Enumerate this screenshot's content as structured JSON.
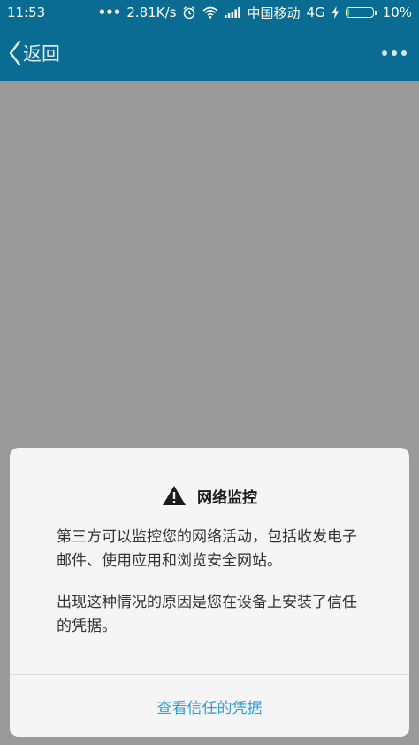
{
  "status_bar": {
    "time": "11:53",
    "dots": "•••",
    "network_speed": "2.81K/s",
    "carrier": "中国移动",
    "network_type": "4G",
    "battery_percent": "10%",
    "battery_level": 0.1,
    "icons": [
      "alarm-icon",
      "wifi-icon",
      "signal-icon",
      "charging-icon",
      "battery-icon"
    ]
  },
  "header": {
    "back_label": "返回",
    "more_icon": "more-icon"
  },
  "dialog": {
    "title": "网络监控",
    "title_icon": "warning-icon",
    "paragraphs": [
      "第三方可以监控您的网络活动，包括收发电子邮件、使用应用和浏览安全网站。",
      "出现这种情况的原因是您在设备上安装了信任的凭据。"
    ],
    "action_label": "查看信任的凭据"
  },
  "colors": {
    "bar": "#0a6c93",
    "overlay": "#9a9a9a",
    "dialog_bg": "#f5f5f5",
    "action": "#2f9fd8"
  }
}
